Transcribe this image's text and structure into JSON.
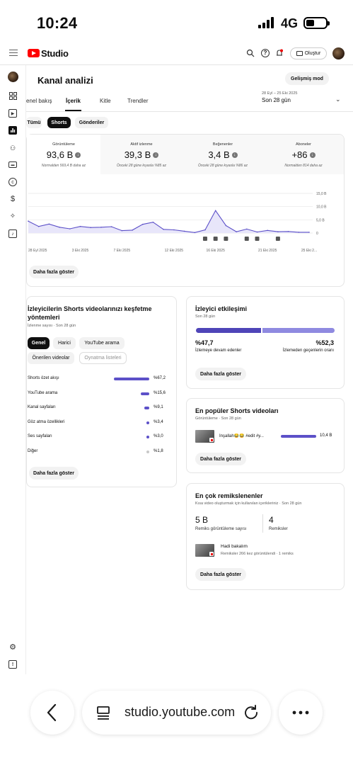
{
  "status": {
    "time": "10:24",
    "network": "4G"
  },
  "header": {
    "logo_text": "Studio",
    "create_label": "Oluştur",
    "icons": [
      "search-icon",
      "help-icon",
      "notification-icon"
    ]
  },
  "rail": {
    "icons": [
      "dashboard-icon",
      "content-icon",
      "analytics-icon",
      "community-icon",
      "subtitles-icon",
      "copyright-icon",
      "earn-icon",
      "customization-icon",
      "audio-library-icon",
      "settings-icon",
      "feedback-icon"
    ]
  },
  "page": {
    "title": "Kanal analizi",
    "advanced_mode": "Gelişmiş mod",
    "tabs": [
      "enel bakış",
      "İçerik",
      "Kitle",
      "Trendler"
    ],
    "active_tab": "İçerik",
    "date_range_small": "28 Eyl – 25 Eki 2025",
    "date_range": "Son 28 gün"
  },
  "filters": [
    "Tümü",
    "Shorts",
    "Gönderiler"
  ],
  "metrics": [
    {
      "label": "Görüntüleme",
      "value": "93,6 B",
      "sub": "Normalden 569,4 B daha az"
    },
    {
      "label": "Aktif izlenme",
      "value": "39,3 B",
      "sub": "Önceki 28 güne kıyasla %85 az"
    },
    {
      "label": "Beğenenler",
      "value": "3,4 B",
      "sub": "Önceki 28 güne kıyasla %86 az"
    },
    {
      "label": "Aboneler",
      "value": "+86",
      "sub": "Normalden 814 daha az"
    }
  ],
  "chart_data": {
    "type": "area",
    "x": [
      "28 Eyl 2025",
      "29 Eyl",
      "30 Eyl",
      "1 Eki",
      "2 Eki",
      "3 Eki 2025",
      "4 Eki",
      "5 Eki",
      "6 Eki",
      "7 Eki 2025",
      "8 Eki",
      "9 Eki",
      "10 Eki",
      "11 Eki",
      "12 Eki 2025",
      "13 Eki",
      "14 Eki",
      "15 Eki",
      "16 Eki 2025",
      "17 Eki",
      "18 Eki",
      "19 Eki",
      "20 Eki",
      "21 Eki 2025",
      "22 Eki",
      "23 Eki",
      "24 Eki",
      "25 Eki 2..."
    ],
    "x_tick_labels": [
      "28 Eyl 2025",
      "3 Eki 2025",
      "7 Eki 2025",
      "12 Eki 2025",
      "16 Eki 2025",
      "21 Eki 2025",
      "25 Eki 2..."
    ],
    "y_tick_labels": [
      "15,0 B",
      "10,0 B",
      "5,0 B",
      "0"
    ],
    "ylim": [
      0,
      15
    ],
    "series": [
      {
        "values": [
          4.5,
          2.5,
          3.4,
          2.2,
          1.6,
          2.5,
          2.1,
          2.2,
          2.4,
          0.9,
          1.1,
          3.3,
          4.1,
          1.4,
          1.2,
          0.7,
          0.2,
          1.2,
          8.5,
          2.8,
          0.5,
          1.5,
          0.4,
          1.0,
          0.5,
          0.6,
          0.3,
          0.3
        ]
      }
    ],
    "grid": true
  },
  "buttons": {
    "show_more": "Daha fazla göster"
  },
  "discovery": {
    "title": "İzleyicilerin Shorts videolarınızı keşfetme yöntemleri",
    "subtitle": "İzlenme sayısı · Son 28 gün",
    "chips": [
      "Genel",
      "Harici",
      "YouTube arama",
      "Önerilen videolar",
      "Oynatma listeleri"
    ],
    "rows": [
      {
        "label": "Shorts özet akışı",
        "pct": "%67,2",
        "value": 67.2
      },
      {
        "label": "YouTube arama",
        "pct": "%15,6",
        "value": 15.6
      },
      {
        "label": "Kanal sayfaları",
        "pct": "%9,1",
        "value": 9.1
      },
      {
        "label": "Göz atma özellikleri",
        "pct": "%3,4",
        "value": 3.4
      },
      {
        "label": "Ses sayfaları",
        "pct": "%3,0",
        "value": 3.0
      },
      {
        "label": "Diğer",
        "pct": "%1,8",
        "value": 1.8
      }
    ]
  },
  "engagement": {
    "title": "İzleyici etkileşimi",
    "subtitle": "Son 28 gün",
    "stay_pct": "%47,7",
    "stay_label": "İzlemeye devam edenler",
    "skip_pct": "%52,3",
    "skip_label": "İzlemeden geçenlerin oranı",
    "stay_value": 47.7
  },
  "popular": {
    "title": "En popüler Shorts videoları",
    "subtitle": "Görüntüleme · Son 28 gün",
    "video_title": "İnşallah😂😂 #edit #y...",
    "video_views": "10,4 B"
  },
  "remix": {
    "title": "En çok remikslenenler",
    "subtitle": "Kısa video oluşturmak için kullanılan içerikleriniz · Son 28 gün",
    "views_value": "5 B",
    "views_label": "Remiks görüntüleme sayısı",
    "count_value": "4",
    "count_label": "Remiksler",
    "video_title": "Hadi bakalım",
    "video_meta": "Remiksler 266 kez görüntülendi · 1 remiks"
  },
  "browser": {
    "url": "studio.youtube.com"
  }
}
